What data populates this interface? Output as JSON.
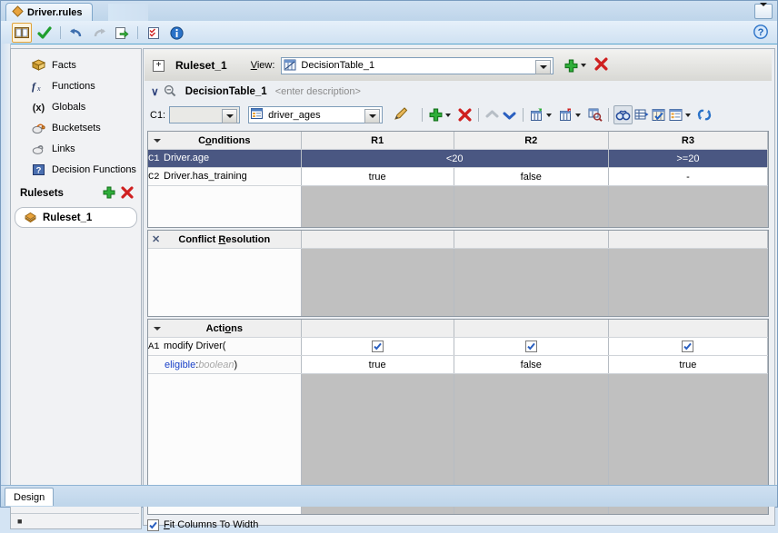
{
  "tab": {
    "title": "Driver.rules",
    "icon": "diamond-orange-icon"
  },
  "toolbar": {
    "items": [
      {
        "name": "dictionary-book-icon",
        "label": "Dictionary"
      },
      {
        "name": "validate-check-icon",
        "label": "Validate"
      },
      {
        "name": "undo-icon",
        "label": "Undo"
      },
      {
        "name": "redo-icon",
        "label": "Redo"
      },
      {
        "name": "export-icon",
        "label": "Export"
      },
      {
        "name": "checklist-icon",
        "label": "Checklist"
      },
      {
        "name": "info-icon",
        "label": "Info"
      }
    ],
    "help_label": "?"
  },
  "sidebar": {
    "items": [
      {
        "label": "Facts",
        "icon": "facts-icon"
      },
      {
        "label": "Functions",
        "icon": "functions-fx-icon"
      },
      {
        "label": "Globals",
        "icon": "globals-x-icon"
      },
      {
        "label": "Bucketsets",
        "icon": "bucketsets-icon"
      },
      {
        "label": "Links",
        "icon": "links-icon"
      },
      {
        "label": "Decision Functions",
        "icon": "decision-functions-icon"
      }
    ],
    "rulesets_label": "Rulesets",
    "add_label": "+",
    "delete_label": "X",
    "rulesets": [
      {
        "label": "Ruleset_1",
        "icon": "ruleset-diamond-icon",
        "selected": true
      }
    ],
    "footer_mark": "■"
  },
  "ruleset_bar": {
    "expander": "+",
    "name": "Ruleset_1",
    "view_label": "View:",
    "view_value": "DecisionTable_1",
    "add_label": "+",
    "delete_label": "X"
  },
  "decision_table": {
    "name": "DecisionTable_1",
    "description_placeholder": "<enter description>",
    "c1_label": "C1:",
    "c1_value": "",
    "bucketset_value": "driver_ages"
  },
  "dt_toolbar": {
    "icons": [
      {
        "name": "add-rule-icon"
      },
      {
        "name": "delete-rule-icon"
      },
      {
        "name": "move-up-icon"
      },
      {
        "name": "move-down-icon"
      },
      {
        "name": "split-table-icon"
      },
      {
        "name": "merge-table-icon"
      },
      {
        "name": "find-gaps-icon"
      },
      {
        "name": "show-conflicts-icon"
      },
      {
        "name": "compact-table-icon"
      },
      {
        "name": "checked-grid-icon"
      },
      {
        "name": "grid-options-icon"
      },
      {
        "name": "refresh-icon"
      }
    ]
  },
  "table": {
    "rule_columns": [
      "R1",
      "R2",
      "R3"
    ],
    "conditions": {
      "header": "Conditions",
      "rows": [
        {
          "id": "C1",
          "label": "Driver.age",
          "selected": true,
          "cells": [
            {
              "value": "<20",
              "span": 2
            },
            {
              "value": ">=20",
              "span": 1
            }
          ]
        },
        {
          "id": "C2",
          "label": "Driver.has_training",
          "selected": false,
          "cells": [
            {
              "value": "true",
              "span": 1
            },
            {
              "value": "false",
              "span": 1
            },
            {
              "value": "-",
              "span": 1
            }
          ]
        }
      ]
    },
    "conflict_resolution": {
      "header": "Conflict Resolution",
      "rows": []
    },
    "actions": {
      "header": "Actions",
      "rows": [
        {
          "id": "A1",
          "label": "modify Driver(",
          "cells": [
            {
              "checked": true
            },
            {
              "checked": true
            },
            {
              "checked": true
            }
          ]
        },
        {
          "id": "",
          "param_name": "eligible",
          "param_sep": ":",
          "param_type": "boolean",
          "param_close": ")",
          "cells": [
            {
              "value": "true"
            },
            {
              "value": "false"
            },
            {
              "value": "true"
            }
          ]
        }
      ]
    }
  },
  "fit_columns": {
    "label": "Fit Columns To Width",
    "checked": true
  },
  "bottom": {
    "design_tab": "Design"
  }
}
